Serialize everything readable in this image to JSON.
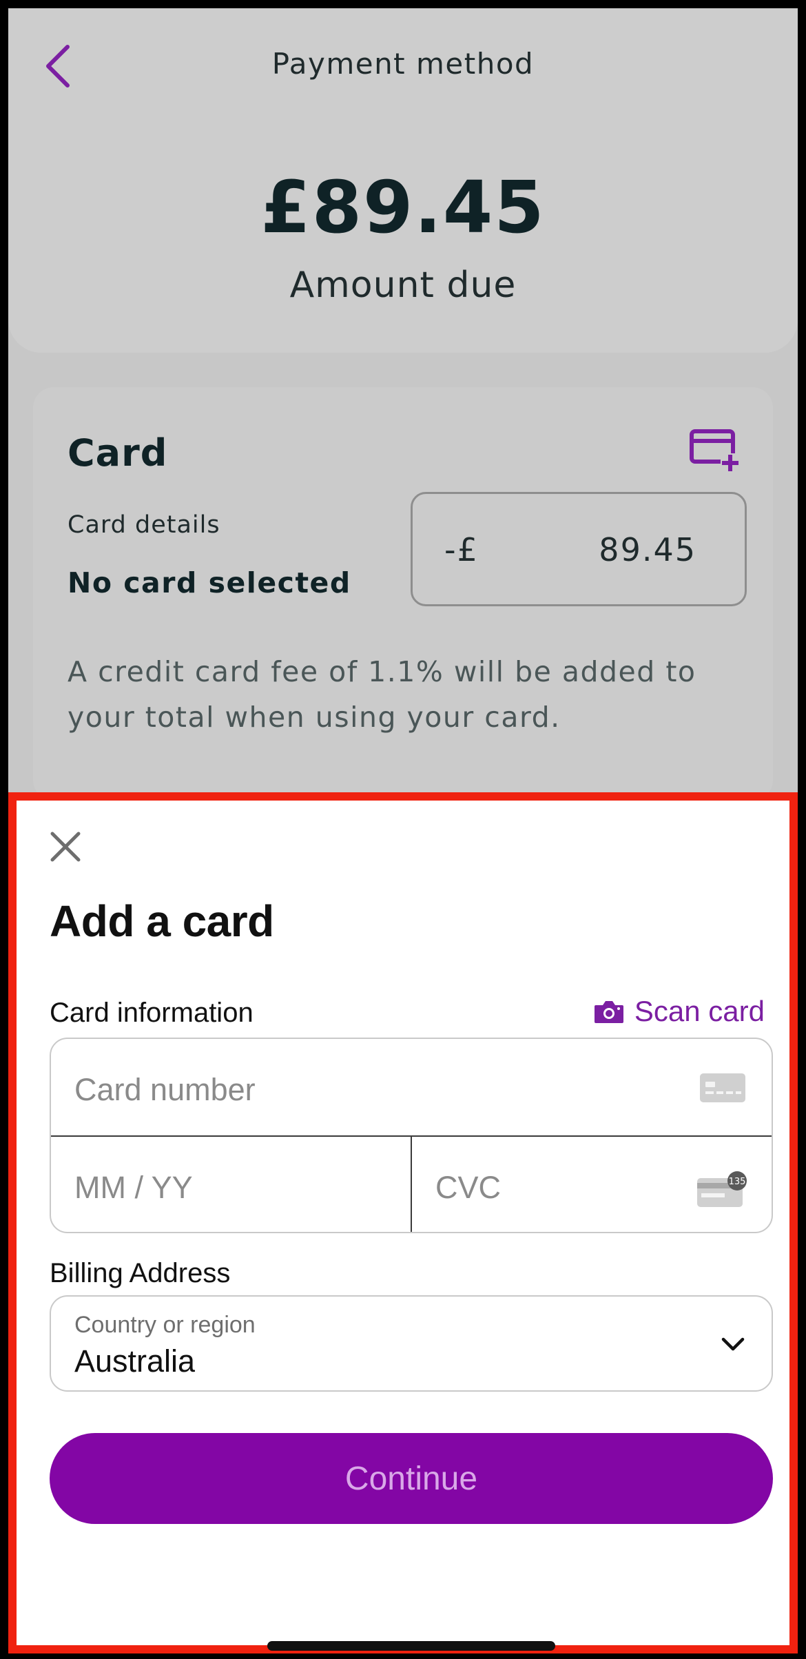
{
  "header": {
    "title": "Payment method",
    "amount": "£89.45",
    "amount_label": "Amount due"
  },
  "card_section": {
    "title": "Card",
    "details_label": "Card details",
    "selected": "No card selected",
    "amount_prefix": "-£",
    "amount_value": "89.45",
    "fee_note": "A credit card fee of 1.1% will be added to your total when using your card."
  },
  "sheet": {
    "title": "Add a card",
    "card_info_label": "Card information",
    "scan_card_label": "Scan card",
    "card_number_placeholder": "Card number",
    "expiry_placeholder": "MM / YY",
    "cvc_placeholder": "CVC",
    "cvc_icon_text": "135",
    "billing_label": "Billing Address",
    "country_label": "Country or region",
    "country_value": "Australia",
    "continue_label": "Continue"
  },
  "icons": {
    "back": "chevron-left-icon",
    "add_card": "add-card-icon",
    "close": "close-icon",
    "camera": "camera-icon",
    "card": "card-icon",
    "cvc": "cvc-card-icon",
    "dropdown": "chevron-down-icon"
  },
  "colors": {
    "accent": "#7b1fa2",
    "button": "#8306a5",
    "highlight_border": "#f02210"
  }
}
